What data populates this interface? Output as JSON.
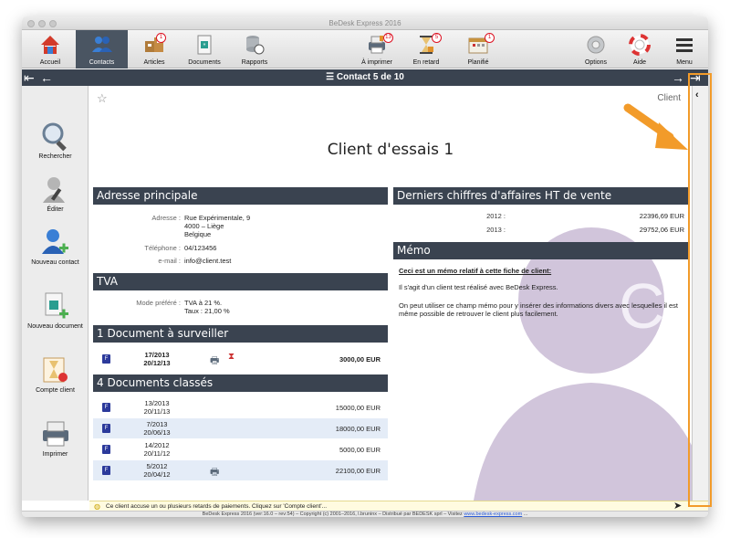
{
  "window": {
    "title": "BeDesk Express 2016"
  },
  "toolbar": {
    "accueil": "Accueil",
    "contacts": "Contacts",
    "articles": "Articles",
    "articles_badge": "1",
    "documents": "Documents",
    "rapports": "Rapports",
    "imprimer": "À imprimer",
    "imprimer_badge": "13",
    "retard": "En retard",
    "retard_badge": "5",
    "planifie": "Planifié",
    "planifie_badge": "1",
    "options": "Options",
    "aide": "Aide",
    "menu": "Menu"
  },
  "nav": {
    "title": "Contact 5 de 10"
  },
  "sidebar": {
    "rechercher": "Rechercher",
    "editer": "Éditer",
    "nouveau_contact": "Nouveau contact",
    "nouveau_document": "Nouveau document",
    "compte_client": "Compte client",
    "imprimer": "Imprimer"
  },
  "contact": {
    "category": "Client",
    "name": "Client d'essais 1"
  },
  "adresse": {
    "header": "Adresse principale",
    "adresse_label": "Adresse :",
    "adresse_line1": "Rue Expérimentale, 9",
    "adresse_line2": "4000 – Liège",
    "adresse_line3": "Belgique",
    "telephone_label": "Téléphone :",
    "telephone": "04/123456",
    "email_label": "e-mail :",
    "email": "info@client.test"
  },
  "tva": {
    "header": "TVA",
    "mode_label": "Mode préféré :",
    "mode_line1": "TVA à 21 %.",
    "mode_line2": "Taux : 21,00 %"
  },
  "surveiller": {
    "header": "1 Document à surveiller",
    "rows": [
      {
        "num": "17/2013",
        "date": "20/12/13",
        "amount": "3000,00 EUR"
      }
    ]
  },
  "classes": {
    "header": "4 Documents classés",
    "rows": [
      {
        "num": "13/2013",
        "date": "20/11/13",
        "amount": "15000,00 EUR"
      },
      {
        "num": "7/2013",
        "date": "20/06/13",
        "amount": "18000,00 EUR"
      },
      {
        "num": "14/2012",
        "date": "20/11/12",
        "amount": "5000,00 EUR"
      },
      {
        "num": "5/2012",
        "date": "20/04/12",
        "amount": "22100,00 EUR"
      }
    ]
  },
  "ca": {
    "header": "Derniers chiffres d'affaires HT de vente",
    "rows": [
      {
        "year": "2012 :",
        "amount": "22396,69 EUR"
      },
      {
        "year": "2013 :",
        "amount": "29752,06 EUR"
      }
    ]
  },
  "memo": {
    "header": "Mémo",
    "title": "Ceci est un mémo relatif à cette fiche de client:",
    "p1": "Il s'agit d'un client test réalisé avec BeDesk Express.",
    "p2": "On peut utiliser ce champ mémo pour y insérer des informations divers avec lesquelles il est même possible de retrouver le client plus facilement."
  },
  "status": {
    "text": "Ce client accuse un ou plusieurs retards de paiements. Cliquez sur 'Compte client'..."
  },
  "footer": {
    "text": "BeDesk Express 2016 (ver:16.0 – rev:54)  –  Copyright (c) 2001–2016, l.bruninx  –  Distribué par BEDESK sprl  –  Visitez ",
    "link": "www.bedesk-express.com",
    "suffix": " ..."
  },
  "colors": {
    "header_bg": "#3a4350",
    "annotation": "#f29b2a",
    "alt_row": "#e4ecf7"
  }
}
